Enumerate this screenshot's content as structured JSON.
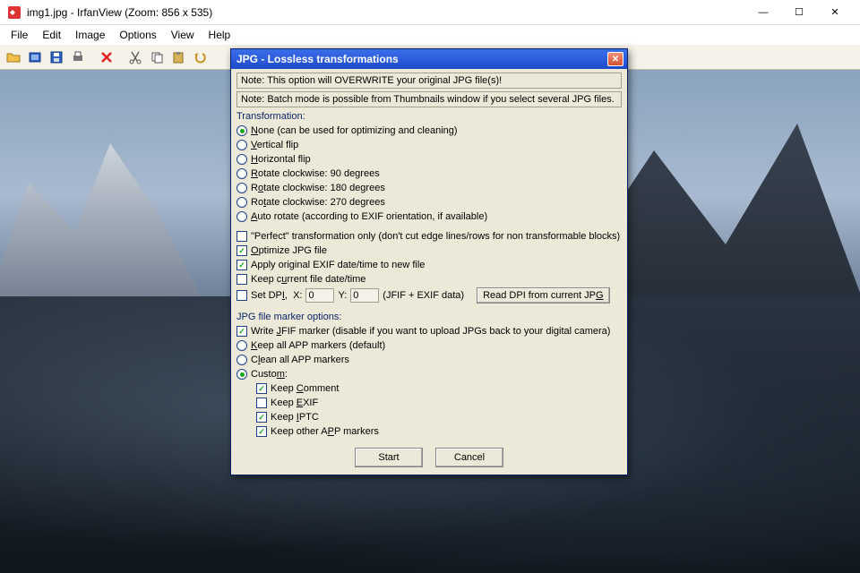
{
  "window": {
    "title": "img1.jpg - IrfanView (Zoom: 856 x 535)",
    "sysbtns": {
      "min": "—",
      "max": "☐",
      "close": "✕"
    }
  },
  "menu": [
    "File",
    "Edit",
    "Image",
    "Options",
    "View",
    "Help"
  ],
  "toolbar_icons": [
    "open",
    "slideshow",
    "save",
    "print",
    "delete",
    "cut",
    "copy",
    "paste",
    "undo"
  ],
  "dialog": {
    "title": "JPG - Lossless transformations",
    "note1": "Note: This option will OVERWRITE your original JPG file(s)!",
    "note2": "Note: Batch mode is possible from Thumbnails window if you  select several JPG files.",
    "transform_caption": "Transformation:",
    "radios": [
      "None (can be used for optimizing and cleaning)",
      "Vertical flip",
      "Horizontal flip",
      "Rotate clockwise: 90 degrees",
      "Rotate clockwise: 180 degrees",
      "Rotate clockwise: 270 degrees",
      "Auto rotate (according to EXIF orientation, if available)"
    ],
    "checks_mid": {
      "perfect": "\"Perfect\" transformation only (don't cut edge lines/rows for non transformable blocks)",
      "optimize": "Optimize JPG file",
      "apply_exif": "Apply original EXIF date/time to new file",
      "keep_date": "Keep current file date/time",
      "set_dpi": "Set DPI,  X:",
      "set_dpi_y": "Y:",
      "set_dpi_tail": "(JFIF + EXIF data)",
      "read_dpi_btn": "Read DPI from current JPG"
    },
    "marker_caption": "JPG file marker options:",
    "write_jfif": "Write JFIF marker (disable if you want to upload JPGs back to your digital camera)",
    "app_radios": [
      "Keep all APP markers (default)",
      "Clean all APP markers",
      "Custom:"
    ],
    "custom_checks": [
      "Keep Comment",
      "Keep EXIF",
      "Keep IPTC",
      "Keep other APP markers"
    ],
    "btn_start": "Start",
    "btn_cancel": "Cancel"
  }
}
